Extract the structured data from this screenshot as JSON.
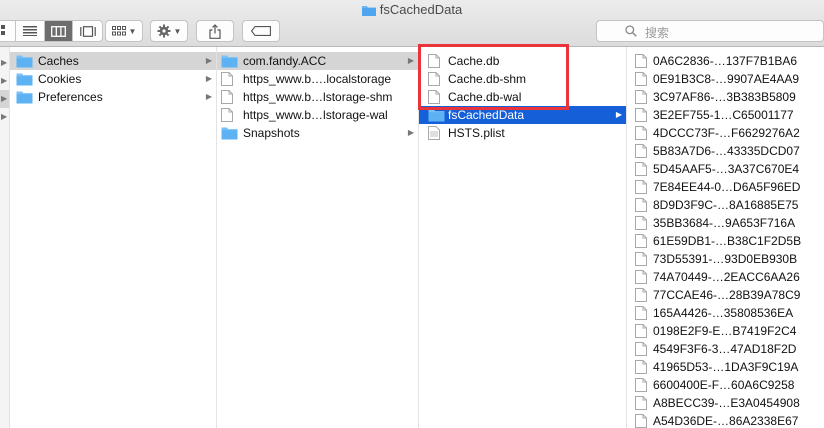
{
  "window": {
    "title": "fsCachedData"
  },
  "toolbar": {
    "views": [
      "icon-view",
      "list-view",
      "column-view",
      "gallery-view"
    ],
    "active_view": "column-view",
    "search_placeholder": "搜索"
  },
  "columns": {
    "col1": {
      "items": [
        {
          "label": "Caches",
          "icon": "folder-icon",
          "arrow": true,
          "state": "selected-inactive"
        },
        {
          "label": "Cookies",
          "icon": "folder-icon",
          "arrow": true
        },
        {
          "label": "Preferences",
          "icon": "folder-icon",
          "arrow": true
        }
      ]
    },
    "col2": {
      "items": [
        {
          "label": "com.fandy.ACC",
          "icon": "folder-icon",
          "arrow": true,
          "state": "selected-inactive"
        },
        {
          "label": "https_www.b….localstorage",
          "icon": "document-icon"
        },
        {
          "label": "https_www.b…lstorage-shm",
          "icon": "document-icon"
        },
        {
          "label": "https_www.b…lstorage-wal",
          "icon": "document-icon"
        },
        {
          "label": "Snapshots",
          "icon": "folder-icon",
          "arrow": true
        }
      ]
    },
    "col3": {
      "items": [
        {
          "label": "Cache.db",
          "icon": "document-icon"
        },
        {
          "label": "Cache.db-shm",
          "icon": "document-icon"
        },
        {
          "label": "Cache.db-wal",
          "icon": "document-icon"
        },
        {
          "label": "fsCachedData",
          "icon": "folder-icon",
          "arrow": true,
          "state": "selected"
        },
        {
          "label": "HSTS.plist",
          "icon": "plist-icon"
        }
      ]
    },
    "col4": {
      "items": [
        {
          "label": "0A6C2836-…137F7B1BA6"
        },
        {
          "label": "0E91B3C8-…9907AE4AA9"
        },
        {
          "label": "3C97AF86-…3B383B5809"
        },
        {
          "label": "3E2EF755-1…C65001177"
        },
        {
          "label": "4DCCC73F-…F6629276A2"
        },
        {
          "label": "5B83A7D6-…43335DCD07"
        },
        {
          "label": "5D45AAF5-…3A37C670E4"
        },
        {
          "label": "7E84EE44-0…D6A5F96ED"
        },
        {
          "label": "8D9D3F9C-…8A16885E75"
        },
        {
          "label": "35BB3684-…9A653F716A"
        },
        {
          "label": "61E59DB1-…B38C1F2D5B"
        },
        {
          "label": "73D55391-…93D0EB930B"
        },
        {
          "label": "74A70449-…2EACC6AA26"
        },
        {
          "label": "77CCAE46-…28B39A78C9"
        },
        {
          "label": "165A4426-…35808536EA"
        },
        {
          "label": "0198E2F9-E…B7419F2C4"
        },
        {
          "label": "4549F3F6-3…47AD18F2D"
        },
        {
          "label": "41965D53-…1DA3F9C19A"
        },
        {
          "label": "6600400E-F…60A6C9258"
        },
        {
          "label": "A8BECC39-…E3A0454908"
        },
        {
          "label": "A54D36DE-…86A2338E67"
        }
      ]
    }
  },
  "highlight": {
    "color": "#e8343a"
  },
  "colors": {
    "selection": "#1560d8",
    "inactive_selection": "#d5d5d5"
  }
}
